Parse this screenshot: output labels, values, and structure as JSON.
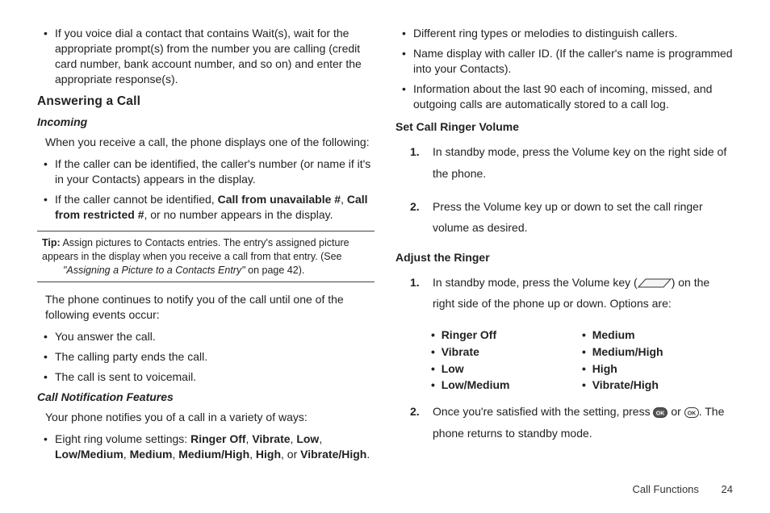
{
  "col1": {
    "bullets_top": [
      "If you voice dial a contact that contains Wait(s), wait for the appropriate prompt(s) from the number you are calling (credit card number, bank account number, and so on) and enter the appropriate response(s)."
    ],
    "answering_heading": "Answering a Call",
    "incoming_heading": "Incoming",
    "incoming_intro": "When you receive a call, the phone displays one of the following:",
    "incoming_bullets": [
      {
        "pre": "If the caller can be identified, the caller's number (or name if it's in your Contacts) appears in the display."
      },
      {
        "pre": "If the caller cannot be identified, ",
        "b1": "Call from unavailable #",
        "mid1": ", ",
        "b2": "Call from restricted #",
        "post": ", or no number appears in the display."
      }
    ],
    "tip": {
      "label": "Tip:",
      "body": " Assign pictures to Contacts entries. The entry's assigned picture appears in the display when you receive a call from that entry. (See",
      "ref": "\"Assigning a Picture to a Contacts Entry\"",
      "ref_tail": " on page 42)."
    },
    "notify_para": "The phone continues to notify you of the call until one of the following events occur:",
    "notify_bullets": [
      "You answer the call.",
      "The calling party ends the call.",
      "The call is sent to voicemail."
    ],
    "call_notif_heading": "Call Notification Features",
    "call_notif_para": "Your phone notifies you of a call in a variety of ways:",
    "volume_bullet": {
      "pre": "Eight ring volume settings: ",
      "b": [
        "Ringer Off",
        "Vibrate",
        "Low",
        "Low/Medium",
        "Medium",
        "Medium/High",
        "High",
        "Vibrate/High"
      ],
      "sep": ", ",
      "or": ", or ",
      "end": "."
    }
  },
  "col2": {
    "top_bullets": [
      "Different ring types or melodies to distinguish callers.",
      "Name display with caller ID. (If the caller's name is programmed into your Contacts).",
      "Information about the last 90 each of incoming, missed, and outgoing calls are automatically stored to a call log."
    ],
    "set_ringer_heading": "Set Call Ringer Volume",
    "set_ringer_steps": [
      "In standby mode, press the Volume key on the right side of the phone.",
      "Press the Volume key up or down to set the call ringer volume as desired."
    ],
    "adjust_heading": "Adjust the Ringer",
    "adjust_step1_pre": "In standby mode, press the Volume key (",
    "adjust_step1_post": ") on the right side of the phone up or down. Options are:",
    "ringer_cols": {
      "left": [
        "Ringer Off",
        "Vibrate",
        "Low",
        "Low/Medium"
      ],
      "right": [
        "Medium",
        "Medium/High",
        "High",
        "Vibrate/High"
      ]
    },
    "adjust_step2_pre": "Once you're satisfied with the setting, press ",
    "adjust_step2_mid": " or ",
    "adjust_step2_post": ". The phone returns to standby mode."
  },
  "footer": {
    "section": "Call Functions",
    "page": "24"
  }
}
